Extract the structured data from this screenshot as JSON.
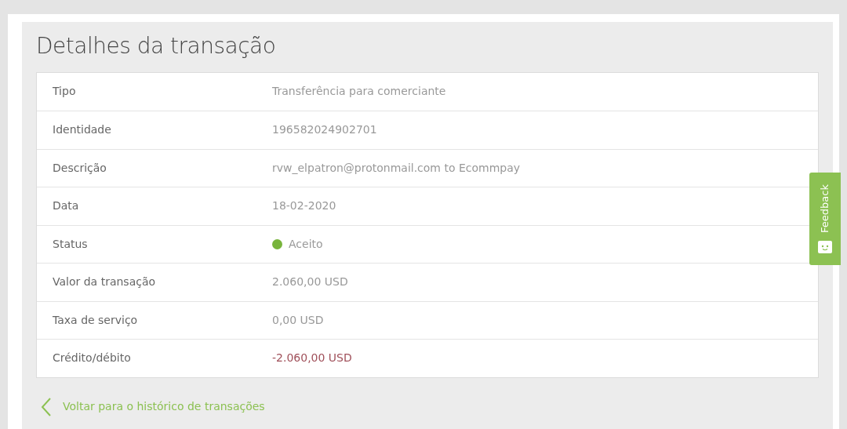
{
  "title": "Detalhes da transação",
  "rows": [
    {
      "label": "Tipo",
      "value": "Transferência para comerciante",
      "kind": "plain"
    },
    {
      "label": "Identidade",
      "value": "196582024902701",
      "kind": "plain"
    },
    {
      "label": "Descrição",
      "value": "rvw_elpatron@protonmail.com to Ecommpay",
      "kind": "plain"
    },
    {
      "label": "Data",
      "value": "18-02-2020",
      "kind": "plain"
    },
    {
      "label": "Status",
      "value": "Aceito",
      "kind": "status",
      "color": "#78b43c"
    },
    {
      "label": "Valor da transação",
      "value": "2.060,00 USD",
      "kind": "plain"
    },
    {
      "label": "Taxa de serviço",
      "value": "0,00 USD",
      "kind": "plain"
    },
    {
      "label": "Crédito/débito",
      "value": "-2.060,00 USD",
      "kind": "debit"
    }
  ],
  "back_link": "Voltar para o histórico de transações",
  "feedback": "Feedback"
}
